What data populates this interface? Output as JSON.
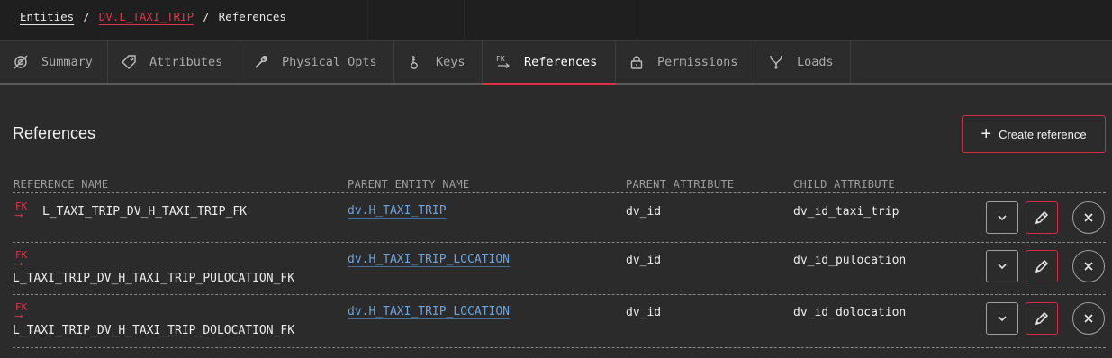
{
  "breadcrumb": {
    "root": "Entities",
    "entity": "DV.L_TAXI_TRIP",
    "current": "References",
    "separator": "/"
  },
  "tabs": [
    {
      "label": "Summary",
      "icon": "target-icon"
    },
    {
      "label": "Attributes",
      "icon": "tag-icon"
    },
    {
      "label": "Physical Opts",
      "icon": "wrench-icon"
    },
    {
      "label": "Keys",
      "icon": "key-icon"
    },
    {
      "label": "References",
      "icon": "fk-icon",
      "active": true
    },
    {
      "label": "Permissions",
      "icon": "lock-icon"
    },
    {
      "label": "Loads",
      "icon": "merge-icon"
    }
  ],
  "section": {
    "title": "References",
    "create_label": "Create reference"
  },
  "table": {
    "columns": [
      "REFERENCE NAME",
      "PARENT ENTITY NAME",
      "PARENT ATTRIBUTE",
      "CHILD ATTRIBUTE"
    ],
    "rows": [
      {
        "name": "L_TAXI_TRIP_DV_H_TAXI_TRIP_FK",
        "parent_entity": "dv.H_TAXI_TRIP",
        "parent_attr": "dv_id",
        "child_attr": "dv_id_taxi_trip"
      },
      {
        "name": "L_TAXI_TRIP_DV_H_TAXI_TRIP_PULOCATION_FK",
        "parent_entity": "dv.H_TAXI_TRIP_LOCATION",
        "parent_attr": "dv_id",
        "child_attr": "dv_id_pulocation"
      },
      {
        "name": "L_TAXI_TRIP_DV_H_TAXI_TRIP_DOLOCATION_FK",
        "parent_entity": "dv.H_TAXI_TRIP_LOCATION",
        "parent_attr": "dv_id",
        "child_attr": "dv_id_dolocation"
      }
    ]
  },
  "fk_badge": "FK",
  "colors": {
    "accent": "#e0324a",
    "link": "#6ba3dc",
    "background": "#2b2b2b"
  }
}
